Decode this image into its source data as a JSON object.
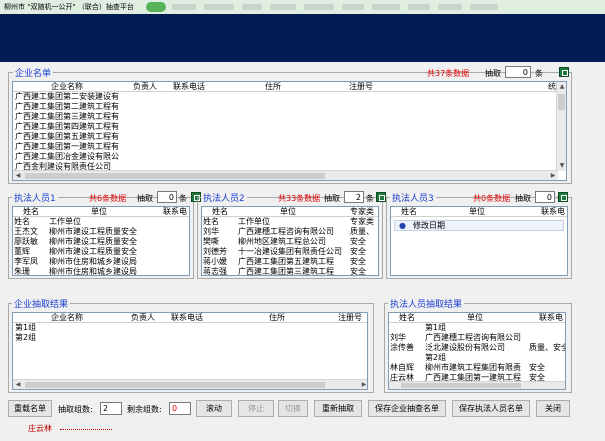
{
  "window": {
    "title": "柳州市 \"双随机一公开\" （联合）抽查平台",
    "badge": ""
  },
  "companies": {
    "title": "企业名单",
    "count": "共37条数据",
    "draw_label": "抽取",
    "draw_value": "0",
    "draw_unit": "条",
    "columns": [
      "企业名称",
      "负责人",
      "联系电话",
      "住所",
      "注册号",
      "统"
    ],
    "rows": [
      "广西建工集团第二安装建设有",
      "广西建工集团第二建筑工程有",
      "广西建工集团第三建筑工程有",
      "广西建工集团第四建筑工程有",
      "广西建工集团第五建筑工程有",
      "广西建工集团第一建筑工程有",
      "广西建工集团冶金建设有限公",
      "广西金利建设有限责任公司"
    ]
  },
  "officers1": {
    "title": "执法人员1",
    "count": "共6条数据",
    "draw_label": "抽取",
    "draw_value": "0",
    "draw_unit": "条",
    "columns": [
      "姓名",
      "单位",
      "联系电"
    ],
    "rows": [
      {
        "name": "姓名",
        "unit": "工作单位"
      },
      {
        "name": "王杰文",
        "unit": "柳州市建设工程质量安全"
      },
      {
        "name": "廖跃敏",
        "unit": "柳州市建设工程质量安全"
      },
      {
        "name": "董辉",
        "unit": "柳州市建设工程质量安全"
      },
      {
        "name": "李军凤",
        "unit": "柳州市住房和城乡建设局"
      },
      {
        "name": "朱珊",
        "unit": "柳州市住房和城乡建设局"
      }
    ]
  },
  "officers2": {
    "title": "执法人员2",
    "count": "共33条数据",
    "draw_label": "抽取",
    "draw_value": "2",
    "draw_unit": "条",
    "columns": [
      "姓名",
      "单位",
      "专家类"
    ],
    "rows": [
      {
        "name": "姓名",
        "unit": "工作单位",
        "extra": "专家类"
      },
      {
        "name": "刘华",
        "unit": "广西建穗工程咨询有限公司",
        "extra": "质量、"
      },
      {
        "name": "樊嘶",
        "unit": "柳州地区建筑工程总公司",
        "extra": "安全"
      },
      {
        "name": "刘德芳",
        "unit": "十一冶建设集团有限责任公司",
        "extra": "安全"
      },
      {
        "name": "蒋小媛",
        "unit": "广西建工集团第五建筑工程",
        "extra": "安全"
      },
      {
        "name": "蒋志强",
        "unit": "广西建工集团第三建筑工程",
        "extra": "安全"
      }
    ]
  },
  "officers3": {
    "title": "执法人员3",
    "count": "共0条数据",
    "draw_label": "抽取",
    "draw_value": "0",
    "draw_unit": "条",
    "columns": [
      "姓名",
      "单位",
      "联系电"
    ],
    "menu_item": "修改日期"
  },
  "company_results": {
    "title": "企业抽取结果",
    "columns": [
      "企业名称",
      "负责人",
      "联系电话",
      "住所",
      "注册号"
    ],
    "rows": [
      "第1组",
      "第2组"
    ]
  },
  "officer_results": {
    "title": "执法人员抽取结果",
    "columns": [
      "姓名",
      "单位",
      "联系电"
    ],
    "rows": [
      {
        "name": "",
        "unit": "第1组",
        "extra": ""
      },
      {
        "name": "刘华",
        "unit": "广西建穗工程咨询有限公司",
        "extra": ""
      },
      {
        "name": "涂传善",
        "unit": "泛北建设股份有限公司",
        "extra": "质量、安全"
      },
      {
        "name": "",
        "unit": "第2组",
        "extra": ""
      },
      {
        "name": "林自辉",
        "unit": "柳州市建筑工程集团有限责",
        "extra": "安全"
      },
      {
        "name": "庄云林",
        "unit": "广西建工集团第一建筑工程",
        "extra": "安全"
      }
    ]
  },
  "controls": {
    "reload": "重载名单",
    "groups_label": "抽取组数:",
    "groups_value": "2",
    "remaining_label": "剩余组数:",
    "remaining_value": "0",
    "roll": "滚动",
    "stop": "停止",
    "switch": "切换",
    "redraw": "重新抽取",
    "save_company": "保存企业抽查名单",
    "save_officer": "保存执法人员名单",
    "close": "关闭"
  },
  "footer": {
    "name": "庄云林"
  },
  "colors": {
    "banner": "#021b55",
    "legend": "#1b3fcf",
    "count": "#e00000",
    "excel": "#1f7a3d"
  }
}
